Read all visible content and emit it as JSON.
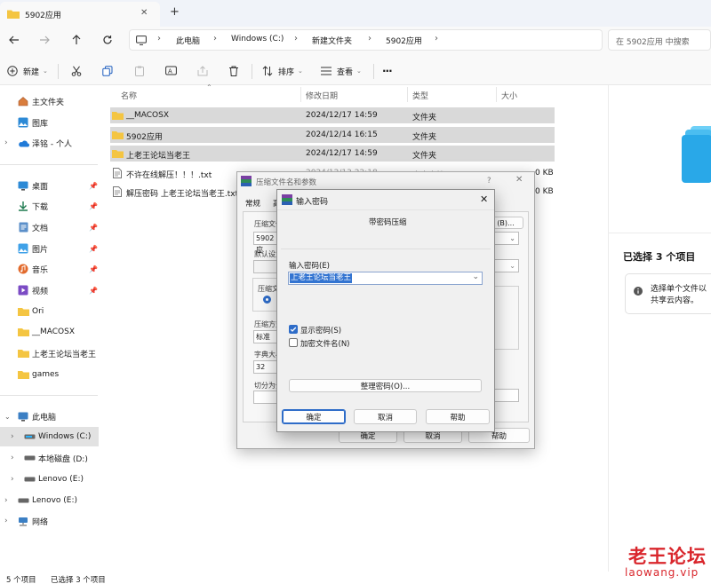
{
  "window": {
    "tab_title": "5902应用",
    "tab_close": "✕",
    "new_tab": "+"
  },
  "address": {
    "crumbs": [
      "此电脑",
      "Windows (C:)",
      "新建文件夹",
      "5902应用"
    ],
    "search_placeholder": "在 5902应用 中搜索"
  },
  "toolbar": {
    "new_label": "新建",
    "sort_label": "排序",
    "view_label": "查看",
    "more_label": "···"
  },
  "sidebar": {
    "quick": [
      {
        "label": "主文件夹",
        "icon": "home-icon"
      },
      {
        "label": "图库",
        "icon": "gallery-icon"
      },
      {
        "label": "泽铭 - 个人",
        "icon": "cloud-icon"
      }
    ],
    "pinned": [
      {
        "label": "桌面",
        "icon": "desktop-icon"
      },
      {
        "label": "下载",
        "icon": "download-icon"
      },
      {
        "label": "文档",
        "icon": "documents-icon"
      },
      {
        "label": "图片",
        "icon": "pictures-icon"
      },
      {
        "label": "音乐",
        "icon": "music-icon"
      },
      {
        "label": "视频",
        "icon": "videos-icon"
      }
    ],
    "folders": [
      "Ori",
      "__MACOSX",
      "上老王论坛当老王",
      "games"
    ],
    "drives": [
      {
        "label": "此电脑",
        "icon": "computer-icon"
      },
      {
        "label": "Windows (C:)",
        "icon": "drive-icon"
      },
      {
        "label": "本地磁盘 (D:)",
        "icon": "drive-icon"
      },
      {
        "label": "Lenovo (E:)",
        "icon": "drive-icon"
      },
      {
        "label": "Lenovo (E:)",
        "icon": "drive-icon"
      },
      {
        "label": "网络",
        "icon": "network-icon"
      }
    ]
  },
  "columns": {
    "name": "名称",
    "date": "修改日期",
    "type": "类型",
    "size": "大小"
  },
  "files": [
    {
      "name": "__MACOSX",
      "date": "2024/12/17 14:59",
      "type": "文件夹",
      "size": "",
      "kind": "folder",
      "selected": true
    },
    {
      "name": "5902应用",
      "date": "2024/12/14 16:15",
      "type": "文件夹",
      "size": "",
      "kind": "folder",
      "selected": true
    },
    {
      "name": "上老王论坛当老王",
      "date": "2024/12/17 14:59",
      "type": "文件夹",
      "size": "",
      "kind": "folder",
      "selected": true
    },
    {
      "name": "不许在线解压！！！.txt",
      "date": "2024/12/13 22:18",
      "type": "文本文档",
      "size": "0 KB",
      "kind": "txt",
      "selected": false
    },
    {
      "name": "解压密码 上老王论坛当老王.txt",
      "date": "",
      "type": "",
      "size": "0 KB",
      "kind": "txt",
      "selected": false
    }
  ],
  "details": {
    "selected_title": "已选择 3 个项目",
    "info_text": [
      "选择单个文件以",
      "共享云内容。"
    ]
  },
  "status": {
    "count": "5 个项目",
    "selected": "已选择 3 个项目"
  },
  "archive_dialog": {
    "title": "压缩文件名和参数",
    "help": "?",
    "close": "✕",
    "tabs": [
      "常规",
      "高"
    ],
    "filename_label": "压缩文件",
    "filename_value": "5902应",
    "browse": "(B)...",
    "default_label": "默认设置",
    "format_label": "压缩文",
    "method_label": "压缩方式",
    "method_value": "标准",
    "dict_label": "字典大小",
    "dict_value": "32",
    "split_label": "切分为分",
    "ok": "确定",
    "cancel": "取消",
    "help_btn": "帮助"
  },
  "password_dialog": {
    "title": "输入密码",
    "close": "✕",
    "heading": "带密码压缩",
    "input_label": "输入密码(E)",
    "input_value": "上老王论坛当老王",
    "show_password": "显示密码(S)",
    "show_password_checked": true,
    "encrypt_names": "加密文件名(N)",
    "encrypt_names_checked": false,
    "manage": "整理密码(O)...",
    "ok": "确定",
    "cancel": "取消",
    "help": "帮助"
  },
  "watermark": {
    "title": "老王论坛",
    "url": "laowang.vip"
  },
  "colors": {
    "folder": "#f4c542",
    "selection": "#d9d9d9",
    "accent": "#2e6cc8",
    "watermark": "#d9262c"
  }
}
